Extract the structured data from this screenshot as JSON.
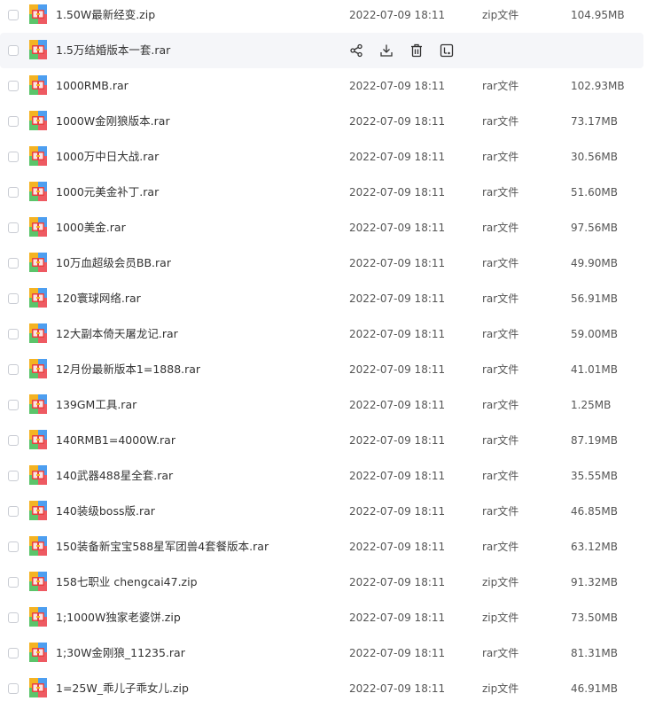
{
  "file_list": {
    "hovered_row_index": 1,
    "hover_actions": [
      "share-icon",
      "download-icon",
      "delete-icon",
      "more-icon"
    ],
    "colors": {
      "hover_background": "#f5f6f9",
      "icon_stroke": "#333333"
    },
    "rows": [
      {
        "name": "1.50W最新经变.zip",
        "date": "2022-07-09 18:11",
        "type": "zip文件",
        "size": "104.95MB"
      },
      {
        "name": "1.5万结婚版本一套.rar",
        "date": "",
        "type": "",
        "size": ""
      },
      {
        "name": "1000RMB.rar",
        "date": "2022-07-09 18:11",
        "type": "rar文件",
        "size": "102.93MB"
      },
      {
        "name": "1000W金刚狼版本.rar",
        "date": "2022-07-09 18:11",
        "type": "rar文件",
        "size": "73.17MB"
      },
      {
        "name": "1000万中日大战.rar",
        "date": "2022-07-09 18:11",
        "type": "rar文件",
        "size": "30.56MB"
      },
      {
        "name": "1000元美金补丁.rar",
        "date": "2022-07-09 18:11",
        "type": "rar文件",
        "size": "51.60MB"
      },
      {
        "name": "1000美金.rar",
        "date": "2022-07-09 18:11",
        "type": "rar文件",
        "size": "97.56MB"
      },
      {
        "name": "10万血超级会员BB.rar",
        "date": "2022-07-09 18:11",
        "type": "rar文件",
        "size": "49.90MB"
      },
      {
        "name": "120寰球网络.rar",
        "date": "2022-07-09 18:11",
        "type": "rar文件",
        "size": "56.91MB"
      },
      {
        "name": "12大副本倚天屠龙记.rar",
        "date": "2022-07-09 18:11",
        "type": "rar文件",
        "size": "59.00MB"
      },
      {
        "name": "12月份最新版本1=1888.rar",
        "date": "2022-07-09 18:11",
        "type": "rar文件",
        "size": "41.01MB"
      },
      {
        "name": "139GM工具.rar",
        "date": "2022-07-09 18:11",
        "type": "rar文件",
        "size": "1.25MB"
      },
      {
        "name": "140RMB1=4000W.rar",
        "date": "2022-07-09 18:11",
        "type": "rar文件",
        "size": "87.19MB"
      },
      {
        "name": "140武器488星全套.rar",
        "date": "2022-07-09 18:11",
        "type": "rar文件",
        "size": "35.55MB"
      },
      {
        "name": "140装级boss版.rar",
        "date": "2022-07-09 18:11",
        "type": "rar文件",
        "size": "46.85MB"
      },
      {
        "name": "150装备新宝宝588星军团兽4套餐版本.rar",
        "date": "2022-07-09 18:11",
        "type": "rar文件",
        "size": "63.12MB"
      },
      {
        "name": "158七职业 chengcai47.zip",
        "date": "2022-07-09 18:11",
        "type": "zip文件",
        "size": "91.32MB"
      },
      {
        "name": "1;1000W独家老婆饼.zip",
        "date": "2022-07-09 18:11",
        "type": "zip文件",
        "size": "73.50MB"
      },
      {
        "name": "1;30W金刚狼_11235.rar",
        "date": "2022-07-09 18:11",
        "type": "rar文件",
        "size": "81.31MB"
      },
      {
        "name": "1=25W_乖儿子乖女儿.zip",
        "date": "2022-07-09 18:11",
        "type": "zip文件",
        "size": "46.91MB"
      }
    ]
  }
}
